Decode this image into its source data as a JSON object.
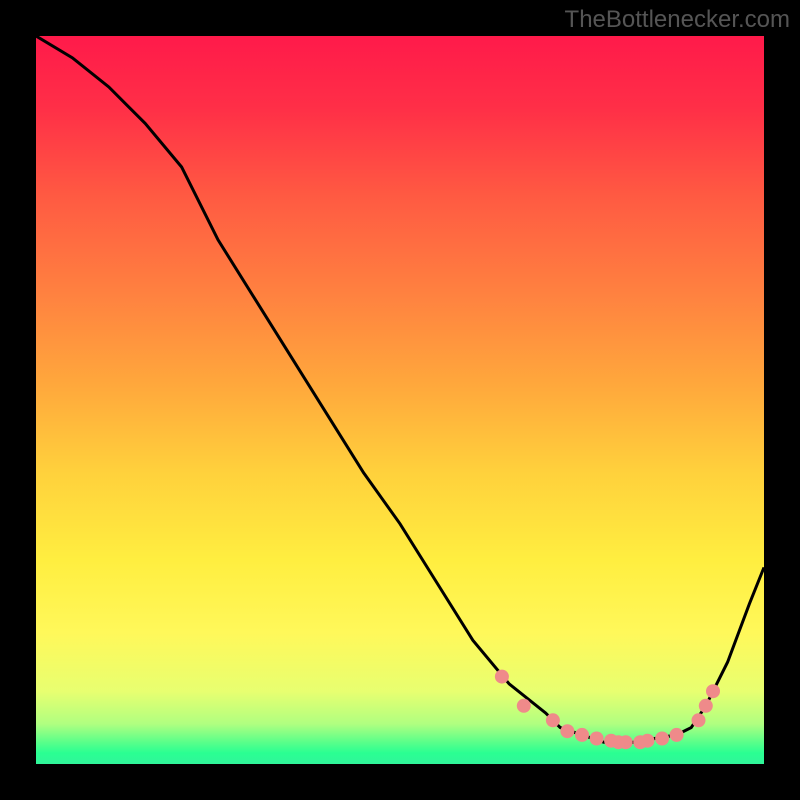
{
  "watermark": "TheBottlenecker.com",
  "chart_data": {
    "type": "line",
    "title": "",
    "xlabel": "",
    "ylabel": "",
    "xlim": [
      0,
      100
    ],
    "ylim": [
      0,
      100
    ],
    "series": [
      {
        "name": "curve",
        "x": [
          0,
          5,
          10,
          15,
          20,
          25,
          30,
          35,
          40,
          45,
          50,
          55,
          60,
          65,
          70,
          72,
          75,
          78,
          80,
          83,
          85,
          88,
          90,
          92,
          95,
          98,
          100
        ],
        "y": [
          100,
          97,
          93,
          88,
          82,
          72,
          64,
          56,
          48,
          40,
          33,
          25,
          17,
          11,
          7,
          5,
          4,
          3,
          3,
          3,
          3.5,
          4,
          5,
          8,
          14,
          22,
          27
        ]
      },
      {
        "name": "highlight-dots",
        "x": [
          64,
          67,
          71,
          73,
          75,
          77,
          79,
          80,
          81,
          83,
          84,
          86,
          88,
          91,
          92,
          93
        ],
        "y": [
          12,
          8,
          6,
          4.5,
          4,
          3.5,
          3.2,
          3,
          3,
          3,
          3.2,
          3.5,
          4,
          6,
          8,
          10
        ]
      }
    ],
    "gradient": {
      "stops": [
        {
          "offset": 0.0,
          "color": "#ff1a4a"
        },
        {
          "offset": 0.1,
          "color": "#ff2f47"
        },
        {
          "offset": 0.22,
          "color": "#ff5a42"
        },
        {
          "offset": 0.35,
          "color": "#ff8040"
        },
        {
          "offset": 0.48,
          "color": "#ffa83c"
        },
        {
          "offset": 0.6,
          "color": "#ffd13c"
        },
        {
          "offset": 0.72,
          "color": "#ffee40"
        },
        {
          "offset": 0.82,
          "color": "#fff85a"
        },
        {
          "offset": 0.9,
          "color": "#e8ff70"
        },
        {
          "offset": 0.945,
          "color": "#b0ff80"
        },
        {
          "offset": 0.97,
          "color": "#5aff8a"
        },
        {
          "offset": 0.985,
          "color": "#2aff92"
        },
        {
          "offset": 1.0,
          "color": "#30f59a"
        }
      ]
    },
    "dot_color": "#ef8a8a",
    "curve_color": "#000000"
  }
}
